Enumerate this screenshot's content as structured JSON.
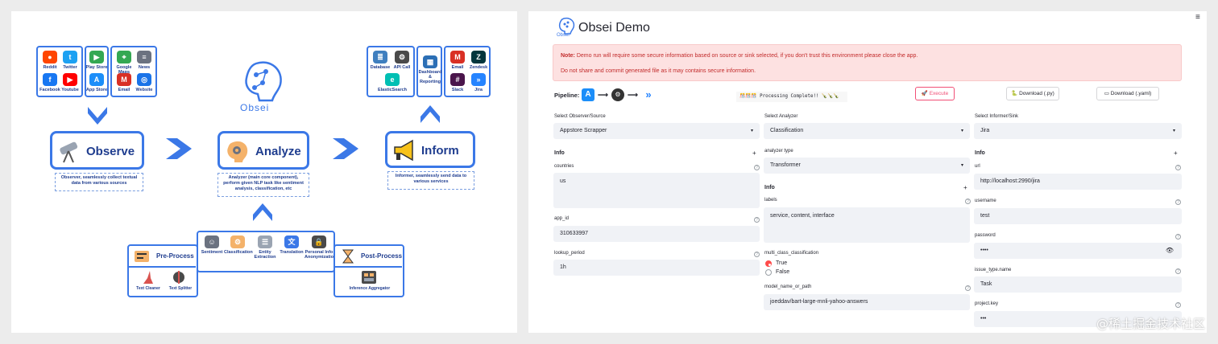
{
  "diagram": {
    "sources": [
      {
        "label": "Reddit",
        "color": "#ff4500",
        "icon": "reddit-icon"
      },
      {
        "label": "Twitter",
        "color": "#1da1f2",
        "icon": "twitter-icon"
      },
      {
        "label": "Facebook",
        "color": "#1877f2",
        "icon": "facebook-icon"
      },
      {
        "label": "Youtube",
        "color": "#ff0000",
        "icon": "youtube-icon"
      }
    ],
    "stores": [
      {
        "label": "Play Store",
        "color": "#34a853",
        "icon": "play-store-icon"
      },
      {
        "label": "App Store",
        "color": "#1c8ef9",
        "icon": "app-store-icon"
      }
    ],
    "web": [
      {
        "label": "Google Maps",
        "color": "#34a853",
        "icon": "google-maps-icon"
      },
      {
        "label": "News",
        "color": "#6b7280",
        "icon": "news-icon"
      },
      {
        "label": "Email",
        "color": "#d93025",
        "icon": "email-icon"
      },
      {
        "label": "Website",
        "color": "#1a73e8",
        "icon": "website-icon"
      }
    ],
    "brand": "Obsei",
    "observe": {
      "label": "Observe",
      "desc": "Observer, seamlessly collect textual data from various sources"
    },
    "analyze": {
      "label": "Analyze",
      "desc": "Analyzer (main core component), perform given NLP task like sentiment analysis, classification, etc"
    },
    "inform": {
      "label": "Inform",
      "desc": "Informer, seamlessly send data to various services"
    },
    "sinks_a": [
      {
        "label": "Database",
        "color": "#3f7fbf",
        "icon": "database-icon"
      },
      {
        "label": "API Call",
        "color": "#4a4a4a",
        "icon": "api-call-icon"
      },
      {
        "label": "ElasticSearch",
        "color": "#00bfb3",
        "icon": "elasticsearch-icon"
      }
    ],
    "sinks_b": [
      {
        "label": "Dashboard & Reporting",
        "color": "#2c6fb5",
        "icon": "dashboard-icon"
      }
    ],
    "sinks_c": [
      {
        "label": "Email",
        "color": "#d93025",
        "icon": "email-icon"
      },
      {
        "label": "Zendesk",
        "color": "#03363d",
        "icon": "zendesk-icon"
      },
      {
        "label": "Slack",
        "color": "#4a154b",
        "icon": "slack-icon"
      },
      {
        "label": "Jira",
        "color": "#2684ff",
        "icon": "jira-icon"
      }
    ],
    "preprocess": {
      "label": "Pre-Process",
      "items": [
        "Text Cleaner",
        "Text Splitter"
      ]
    },
    "analyzers": [
      "Sentiment",
      "Classification",
      "Entity Extraction",
      "Translation",
      "Personal Info Anonymization"
    ],
    "postprocess": {
      "label": "Post-Process",
      "items": [
        "Inference Aggregator"
      ]
    }
  },
  "app": {
    "title": "Obsei Demo",
    "logo_text": "Obsei",
    "menu_icon": "hamburger-icon",
    "note_prefix": "Note:",
    "note_line1": "Demo run will require some secure information based on source or sink selected, if you don't trust this environment please close the app.",
    "note_line2": "Do not share and commit generated file as it may contains secure information.",
    "pipeline_label": "Pipeline:",
    "status": "🎊🎊🎊 Processing Complete!! 🍾🍾🍾",
    "execute_label": "Execute",
    "download_py": "Download (.py)",
    "download_yaml": "Download (.yaml)",
    "observer": {
      "label": "Select Observer/Source",
      "value": "Appstore Scrapper",
      "info": "Info",
      "fields": {
        "countries_label": "countries",
        "countries_value": "us",
        "app_id_label": "app_id",
        "app_id_value": "310633997",
        "lookup_label": "lookup_period",
        "lookup_value": "1h"
      }
    },
    "analyzer": {
      "label": "Select Analyzer",
      "value": "Classification",
      "type_label": "analyzer type",
      "type_value": "Transformer",
      "info": "Info",
      "labels_label": "labels",
      "labels_value": "service, content, interface",
      "multi_label": "multi_class_classification",
      "opt_true": "True",
      "opt_false": "False",
      "model_label": "model_name_or_path",
      "model_value": "joeddav/bart-large-mnli-yahoo-answers"
    },
    "informer": {
      "label": "Select Informer/Sink",
      "value": "Jira",
      "info": "Info",
      "url_label": "url",
      "url_value": "http://localhost:2990/jira",
      "username_label": "username",
      "username_value": "test",
      "password_label": "password",
      "password_value": "••••",
      "issue_label": "issue_type.name",
      "issue_value": "Task",
      "project_label": "project.key",
      "project_value": "•••"
    }
  },
  "watermark": "@稀土掘金技术社区"
}
